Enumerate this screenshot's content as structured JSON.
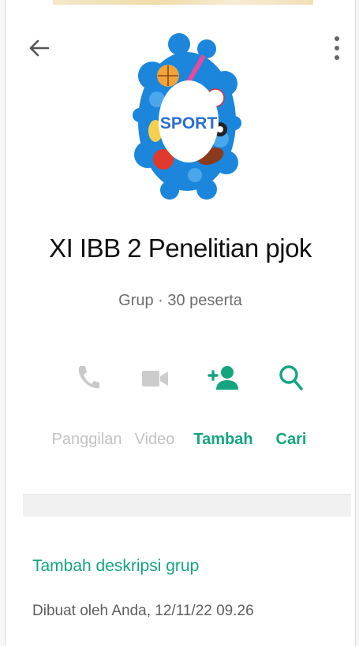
{
  "header": {
    "back_icon": "arrow-left-icon",
    "menu_icon": "more-vertical-icon"
  },
  "avatar": {
    "text": "SPORT",
    "colors": {
      "splash": "#1b86dc",
      "label": "#2a6fd0"
    }
  },
  "group": {
    "name": "XI IBB 2 Penelitian pjok",
    "meta": "Grup · 30 peserta"
  },
  "actions": [
    {
      "label": "Panggilan",
      "icon": "phone-icon",
      "enabled": false
    },
    {
      "label": "Video",
      "icon": "video-camera-icon",
      "enabled": false
    },
    {
      "label": "Tambah",
      "icon": "add-person-icon",
      "enabled": true
    },
    {
      "label": "Cari",
      "icon": "search-icon",
      "enabled": true
    }
  ],
  "description": {
    "add_link": "Tambah deskripsi grup",
    "created_by": "Dibuat oleh Anda, 12/11/22 09.26"
  },
  "colors": {
    "accent": "#14a57f",
    "disabled": "#c2c2c2",
    "text": "#111111"
  }
}
